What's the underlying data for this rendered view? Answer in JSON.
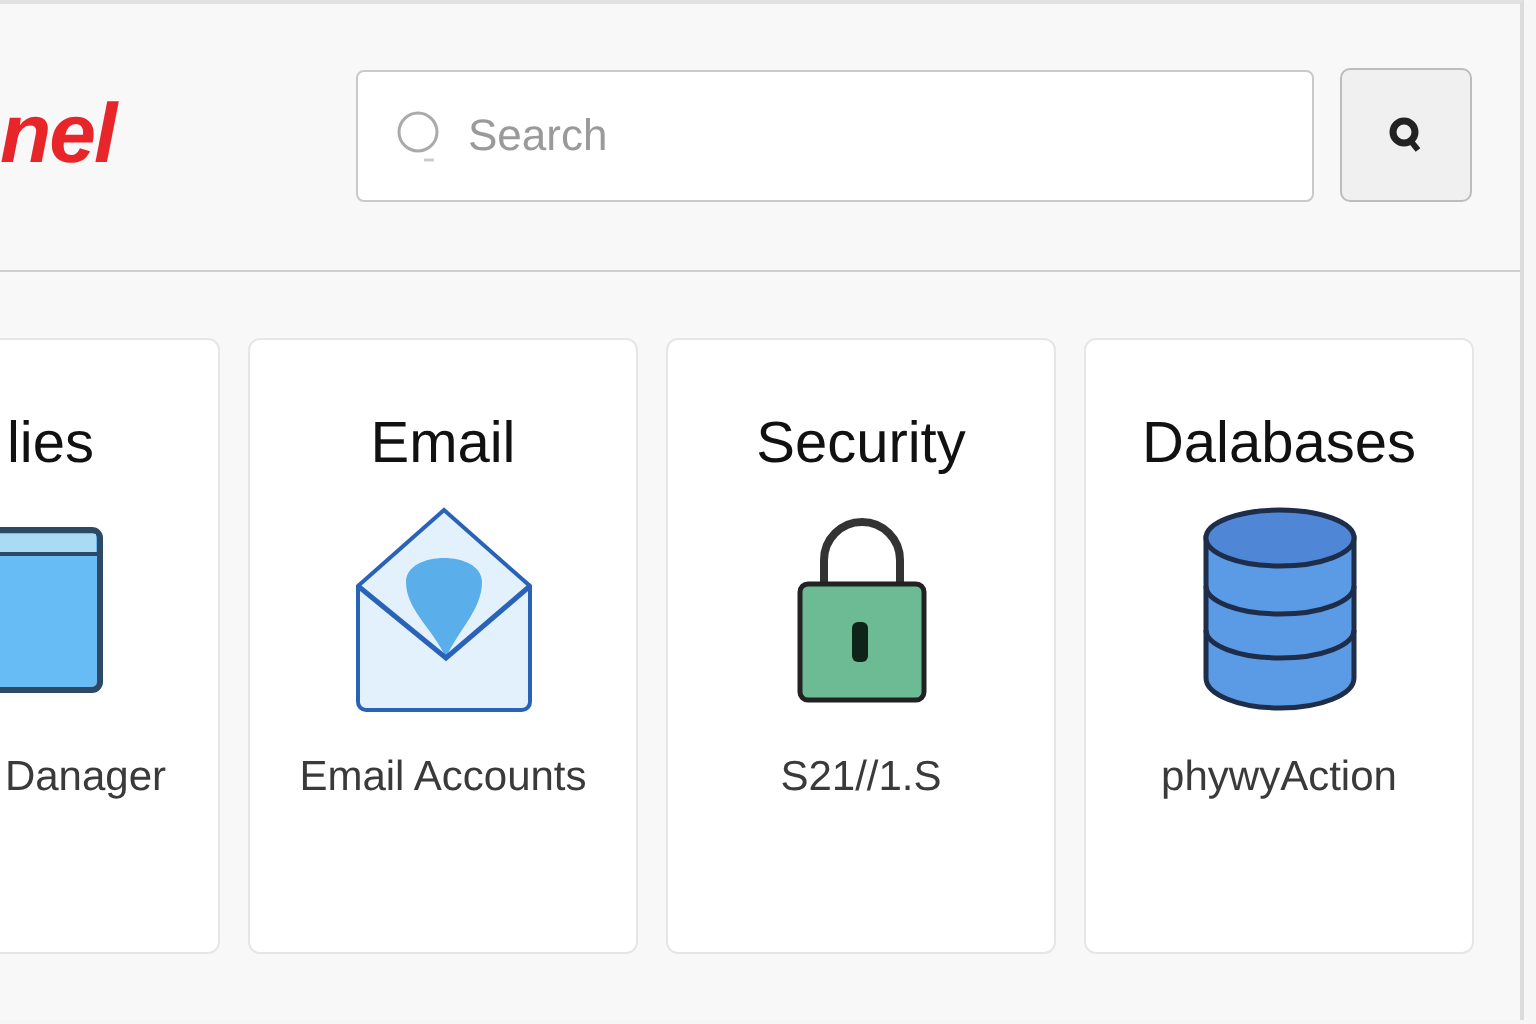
{
  "header": {
    "logo": "nel",
    "search": {
      "placeholder": "Search"
    }
  },
  "cards": [
    {
      "kind": "window",
      "title": "lies",
      "caption": "Danager",
      "cut": true
    },
    {
      "kind": "email",
      "title": "Email",
      "caption": "Email Accounts",
      "cut": false
    },
    {
      "kind": "security",
      "title": "Security",
      "caption": "S21//1.S",
      "cut": false
    },
    {
      "kind": "databases",
      "title": "Dalabases",
      "caption": "phywyAction",
      "cut": false
    }
  ]
}
